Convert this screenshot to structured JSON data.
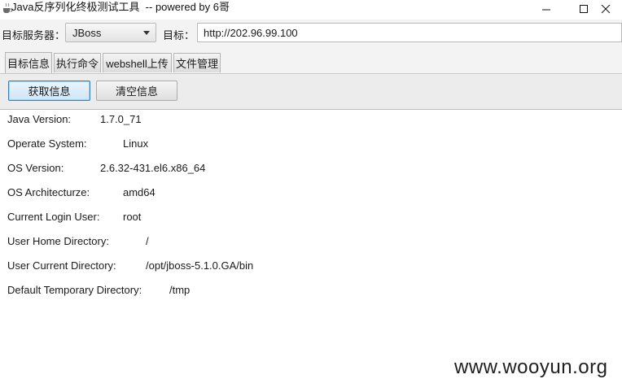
{
  "window": {
    "title": "Java反序列化终极测试工具  -- powered by 6哥"
  },
  "toolbar": {
    "server_label": "目标服务器：",
    "server_selected": "JBoss",
    "target_label": "目标：",
    "target_value": "http://202.96.99.100"
  },
  "tabs": [
    {
      "label": "目标信息"
    },
    {
      "label": "执行命令"
    },
    {
      "label": "webshell上传"
    },
    {
      "label": "文件管理"
    }
  ],
  "actions": {
    "fetch_label": "获取信息",
    "clear_label": "清空信息"
  },
  "info": [
    {
      "label": "Java Version:",
      "value": "1.7.0_71"
    },
    {
      "label": "Operate System:",
      "value": "Linux"
    },
    {
      "label": "OS Version:",
      "value": "2.6.32-431.el6.x86_64"
    },
    {
      "label": "OS Architecturze:",
      "value": "amd64"
    },
    {
      "label": "Current Login User:",
      "value": "root"
    },
    {
      "label": "User Home Directory:",
      "value": "/"
    },
    {
      "label": "User Current Directory:",
      "value": "/opt/jboss-5.1.0.GA/bin"
    },
    {
      "label": "Default Temporary Directory:",
      "value": "/tmp"
    }
  ],
  "watermark": "www.wooyun.org",
  "icons": {
    "app": "java-cup-icon",
    "minimize": "minimize-icon",
    "maximize": "maximize-icon",
    "close": "close-icon",
    "dropdown": "chevron-down-icon"
  },
  "colors": {
    "active_button_border": "#3c7fb1",
    "panel_background": "#ffffff",
    "toolbar_background": "#f3f3f3"
  }
}
